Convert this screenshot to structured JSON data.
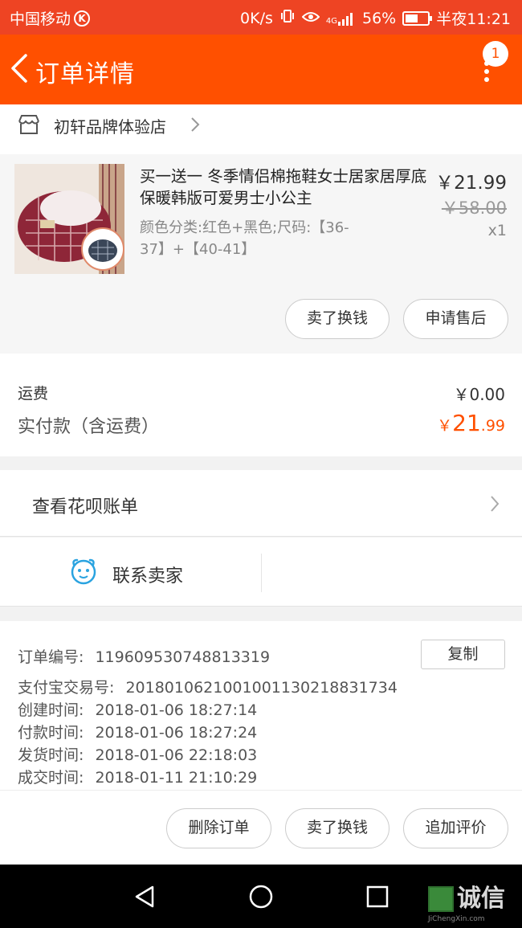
{
  "status_bar": {
    "carrier": "中国移动",
    "carrier_badge": "K",
    "speed": "0K/s",
    "network": "4G",
    "battery": "56%",
    "battery_level": 0.56,
    "time": "半夜11:21"
  },
  "navbar": {
    "title": "订单详情",
    "badge": "1"
  },
  "shop": {
    "name": "初轩品牌体验店"
  },
  "item": {
    "name": "买一送一 冬季情侣棉拖鞋女士居家居厚底保暖韩版可爱男士小公主",
    "sku": "颜色分类:红色+黑色;尺码:【36-37】+【40-41】",
    "price": "￥21.99",
    "original_price": "￥58.00",
    "quantity": "x1",
    "btn_sell": "卖了换钱",
    "btn_aftersale": "申请售后"
  },
  "fees": {
    "shipping_label": "运费",
    "shipping_value": "￥0.00",
    "paid_label": "实付款（含运费）",
    "paid_currency": "￥",
    "paid_int": "21",
    "paid_dec": ".99"
  },
  "huabei": {
    "label": "查看花呗账单"
  },
  "contact": {
    "label": "联系卖家"
  },
  "order_info": {
    "order_no_label": "订单编号:",
    "order_no": "119609530748813319",
    "copy_label": "复制",
    "alipay_label": "支付宝交易号:",
    "alipay_no": "2018010621001001130218831734",
    "created_label": "创建时间:",
    "created": "2018-01-06 18:27:14",
    "paid_label": "付款时间:",
    "paid": "2018-01-06 18:27:24",
    "shipped_label": "发货时间:",
    "shipped": "2018-01-06 22:18:03",
    "done_label": "成交时间:",
    "done": "2018-01-11 21:10:29"
  },
  "actions": {
    "delete": "删除订单",
    "sell": "卖了换钱",
    "review": "追加评价"
  },
  "watermark": {
    "text": "诚信",
    "sub": "JiChengXin.com"
  },
  "colors": {
    "status_bar": "#ee4423",
    "navbar": "#ff5000",
    "price_accent": "#ff5000",
    "contact_icon": "#2aa3e0"
  }
}
